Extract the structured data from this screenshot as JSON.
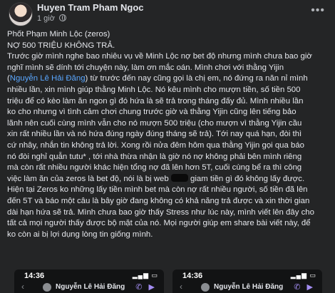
{
  "header": {
    "author": "Huyen Tram Pham Ngoc",
    "time": "1 giờ",
    "more": "•••"
  },
  "post": {
    "l1": "Phốt Phạm Minh Lộc (zeros)",
    "l2": "NỢ 500 TRIỆU KHÔNG TRẢ.",
    "l3": "Trước giờ mình nghe bao nhiêu vụ về Minh Lộc nợ bet độ nhưng mình chưa bao giờ",
    "l4": "nghĩ mình sẽ dính tới chuyện này, làm ơn mắc oán. Mình chơi với thằng Yijin",
    "l5a": "(",
    "l5link": "Nguyễn Lê Hải Đăng",
    "l5b": ") từ trước đến nay cũng gọi là chị em, nó đứng ra năn nỉ mình",
    "l6": "nhiều lần, xin mình giúp thằng Minh Lộc. Nó kêu mình cho mượn tiền, số tiền 500",
    "l7": "triệu để có kèo làm ăn ngon gì đó hứa là sẽ trả trong tháng đấy đủ. Mình nhiều lần",
    "l8": "ko cho nhưng vì tình cảm chơi chung trước giờ và thằng Yijin cũng lên tiếng bảo",
    "l9": "lãnh nên cuối cùng mình vẫn cho nó mượn 500 triệu (cho mượn vì thằng Yijin cầu",
    "l10": "xin rất nhiều lần và nó hứa đúng ngày đúng tháng sẽ trả). Tới nay quá hạn, đòi thì",
    "l11": "cứ nhây, nhắn tin không trả lời. Xong rồi nửa đêm hôm qua thằng Yijin gọi qua báo",
    "l12": "nó đòi nghỉ quẫn tutu* , tới nhà thừa nhận là giờ nó nợ không phải bên mình riêng",
    "l13": "mà còn rất nhiều người khác hiện tổng nợ đã lên hơn 5T, cuối cùng bể ra thì công",
    "l14a": "việc làm ăn của zeros là bet độ, nói là bị web",
    "l14b": "giam tiền gì đó không lấy được.",
    "l15": "Hiện tại Zeros ko những lấy tiền mình bet mà còn nợ rất nhiều người, số tiền đã lên",
    "l16": "đến 5T và báo một câu là bây giờ đang không có khả năng trả được và xin thời gian",
    "l17": "dài hạn hứa sẽ trả. Mình chưa bao giờ thấy Stress như lúc này, mình viết lên đây cho",
    "l18": "tất cả mọi người thấy được bộ mặt của nó. Mọi người giúp em share bài viết này, để",
    "l19": "ko còn ai bị lợi dụng lòng tin giống mình."
  },
  "screenshots": [
    {
      "time": "14:36",
      "chat_name": "Nguyễn Lê Hải Đăng"
    },
    {
      "time": "14:36",
      "chat_name": "Nguyễn Lê Hải Đăng"
    }
  ],
  "colors": {
    "background": "#242526",
    "text": "#e4e6eb",
    "link": "#5aa7ff",
    "accent_icons": "#a38df2"
  }
}
